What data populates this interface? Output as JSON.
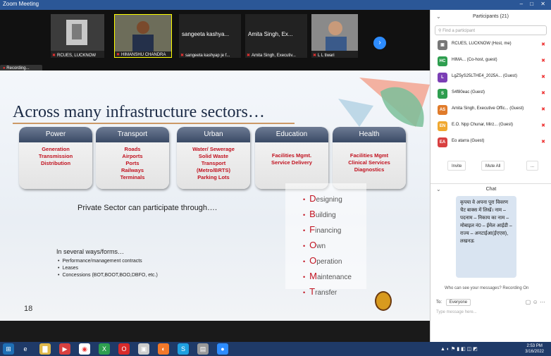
{
  "window": {
    "title": "Zoom Meeting",
    "controls": "– □ ✕"
  },
  "gallery": {
    "tiles": [
      {
        "caption": "RCUES, LUCKNOW",
        "name": ""
      },
      {
        "caption": "HIMANSHU CHANDRA",
        "name": ""
      },
      {
        "caption": "sangeeta kashyap je f...",
        "name": "sangeeta kashya..."
      },
      {
        "caption": "Amita Singh, Executiv...",
        "name": "Amita Singh, Ex..."
      },
      {
        "caption": "L L tiwari",
        "name": ""
      }
    ],
    "next_glyph": "›",
    "recording": "Recording..."
  },
  "slide": {
    "title": "Across many infrastructure sectors…",
    "sectors": [
      {
        "name": "Power",
        "items": [
          "Generation",
          "Transmission",
          "Distribution"
        ]
      },
      {
        "name": "Transport",
        "items": [
          "Roads",
          "Airports",
          "Ports",
          "Railways",
          "Terminals"
        ]
      },
      {
        "name": "Urban",
        "items": [
          "Water/ Sewerage",
          "Solid Waste",
          "Transport",
          "(Metro/BRTS)",
          "Parking Lots"
        ]
      },
      {
        "name": "Education",
        "items": [
          "Facilities Mgmt.",
          "Service Delivery"
        ]
      },
      {
        "name": "Health",
        "items": [
          "Facilities Mgmt",
          "Clinical Services",
          "Diagnostics"
        ]
      }
    ],
    "private_sector": "Private Sector can participate through….",
    "ways_heading": "In several ways/forms…",
    "ways": [
      "Performance/management contracts",
      "Leases",
      "Concessions (BOT,BOOT,BOO,DBFO, etc.)"
    ],
    "dbfoo": [
      {
        "initial": "D",
        "rest": "esigning"
      },
      {
        "initial": "B",
        "rest": "uilding"
      },
      {
        "initial": "F",
        "rest": "inancing"
      },
      {
        "initial": "O",
        "rest": "wn"
      },
      {
        "initial": "O",
        "rest": "peration"
      },
      {
        "initial": "M",
        "rest": "aintenance"
      },
      {
        "initial": "T",
        "rest": "ransfer"
      }
    ],
    "page_number": "18"
  },
  "participants": {
    "header": "Participants (21)",
    "search_placeholder": "Find a participant",
    "list": [
      {
        "initials": "",
        "color": "#777777",
        "name": "RCUES, LUCKNOW (Host, me)"
      },
      {
        "initials": "HC",
        "color": "#2e9e4f",
        "name": "HIMA... (Co-host, guest)"
      },
      {
        "initials": "L",
        "color": "#7b3fb5",
        "name": "LgZ5yS25LTHE4_2025A... (Guest)"
      },
      {
        "initials": "S",
        "color": "#2e9e4f",
        "name": "S4f80eac (Guest)"
      },
      {
        "initials": "AS",
        "color": "#e07b2a",
        "name": "Amita Singh, Executive Offic... (Guest)"
      },
      {
        "initials": "EN",
        "color": "#f0a830",
        "name": "E.O. Npp Chunar, Mirz... (Guest)"
      },
      {
        "initials": "EA",
        "color": "#d84040",
        "name": "Eo atarra (Guest)"
      }
    ],
    "buttons": {
      "invite": "Invite",
      "mute_all": "Mute All",
      "more": "..."
    }
  },
  "chat": {
    "header": "Chat",
    "message": "कृपया वे अपना पूरा विवरण चैट बाक्स में लिखें। नाम – पदनाम – निकाय का नाम – मोबाइल नं0 – ईमेल आईडी – राज्य – अनटाईआ(ईएएस), लखनऊ",
    "who_can_see": "Who can see your messages? Recording On",
    "to_label": "To:",
    "to_value": "Everyone",
    "type_placeholder": "Type message here..."
  },
  "taskbar": {
    "time": "2:53 PM",
    "date": "3/16/2022"
  }
}
